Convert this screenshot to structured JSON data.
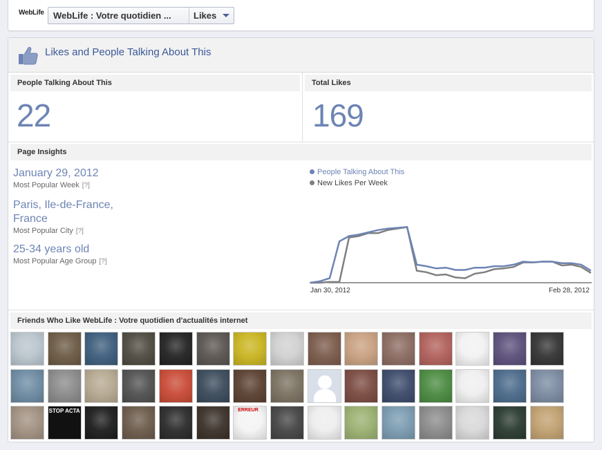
{
  "header": {
    "brand": "WebLife",
    "page_selector": "WebLife : Votre quotidien ...",
    "view_selector": "Likes"
  },
  "panel": {
    "title": "Likes and People Talking About This",
    "icon": "thumbs-up-icon"
  },
  "stats": {
    "talking": {
      "label": "People Talking About This",
      "value": "22"
    },
    "likes": {
      "label": "Total Likes",
      "value": "169"
    }
  },
  "insights": {
    "title": "Page Insights",
    "help": "[?]",
    "items": [
      {
        "value": "January 29, 2012",
        "label": "Most Popular Week"
      },
      {
        "value": "Paris, Ile-de-France, France",
        "label": "Most Popular City"
      },
      {
        "value": "25-34 years old",
        "label": "Most Popular Age Group"
      }
    ]
  },
  "chart_data": {
    "type": "line",
    "x_start_label": "Jan 30, 2012",
    "x_end_label": "Feb 28, 2012",
    "grid": false,
    "series": [
      {
        "name": "People Talking About This",
        "color": "#6d84b4",
        "values": [
          0,
          2,
          6,
          55,
          62,
          64,
          67,
          70,
          72,
          73,
          74,
          24,
          22,
          19,
          20,
          17,
          17,
          20,
          20,
          22,
          22,
          24,
          28,
          27,
          28,
          28,
          26,
          26,
          24,
          16
        ]
      },
      {
        "name": "New Likes Per Week",
        "color": "#7f7f7f",
        "values": [
          0,
          0,
          1,
          1,
          60,
          62,
          66,
          66,
          70,
          72,
          74,
          16,
          14,
          10,
          11,
          7,
          6,
          12,
          14,
          18,
          19,
          21,
          27,
          27,
          28,
          28,
          23,
          24,
          21,
          13
        ]
      }
    ]
  },
  "friends": {
    "title": "Friends Who Like WebLife : Votre quotidien d'actualités internet",
    "stop_acta_text": "STOP ACTA",
    "erreur_text": "ERREUR",
    "avatar_colors": [
      "#b9c4cc",
      "#6b5a44",
      "#3c5d7c",
      "#4e4a40",
      "#222222",
      "#5a5450",
      "#c9b420",
      "#d0d0d0",
      "#7a5a4a",
      "#c8a080",
      "#8a6a60",
      "#b0605a",
      "#f2f2f2",
      "#5b4f7a",
      "#333333",
      "#6c8aa2",
      "#8a8a8a",
      "#b5a890",
      "#505050",
      "#c84a36",
      "#3a4a5a",
      "#5a4030",
      "#7a7060",
      "#d8dfe9",
      "#7a4a40",
      "#3b4a6a",
      "#4a8a40",
      "#efefef",
      "#4a6a8a",
      "#7a8aa0",
      "#a09080",
      "#111111",
      "#1c1c1c",
      "#6a5a4a",
      "#2a2a2a",
      "#3a3028",
      "#f4f4f4",
      "#444444",
      "#eeeeee",
      "#9ab070",
      "#7a9ab0",
      "#8a8a8a",
      "#d8d8d8",
      "#2a3a30",
      "#c0a070"
    ]
  }
}
